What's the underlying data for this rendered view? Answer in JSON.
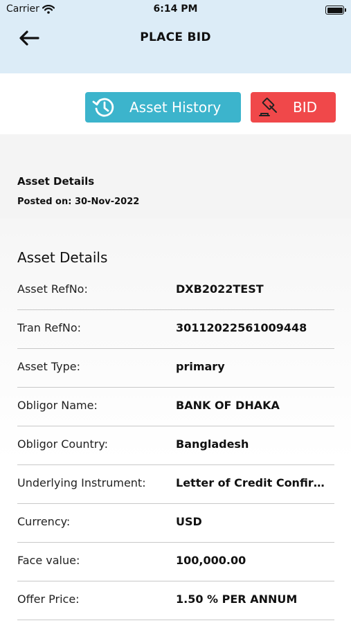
{
  "status_bar": {
    "carrier": "Carrier",
    "time": "6:14 PM"
  },
  "nav": {
    "title": "PLACE BID"
  },
  "actions": {
    "history_label": "Asset History",
    "bid_label": "BID"
  },
  "summary": {
    "title": "Asset Details",
    "posted": "Posted on: 30-Nov-2022"
  },
  "details": {
    "title": "Asset Details",
    "rows": [
      {
        "label": "Asset RefNo:",
        "value": "DXB2022TEST"
      },
      {
        "label": "Tran RefNo:",
        "value": "30112022561009448"
      },
      {
        "label": "Asset Type:",
        "value": "primary"
      },
      {
        "label": "Obligor Name:",
        "value": "BANK OF DHAKA"
      },
      {
        "label": "Obligor Country:",
        "value": "Bangladesh"
      },
      {
        "label": "Underlying Instrument:",
        "value": "Letter of Credit Confirm..."
      },
      {
        "label": "Currency:",
        "value": "USD"
      },
      {
        "label": "Face value:",
        "value": "100,000.00"
      },
      {
        "label": "Offer Price:",
        "value": "1.50 % PER ANNUM"
      }
    ]
  },
  "colors": {
    "header_bg": "#dcecf7",
    "history_button": "#3cb4cc",
    "bid_button": "#f0484a"
  },
  "icons": [
    "wifi-icon",
    "battery-icon",
    "back-arrow-icon",
    "history-icon",
    "gavel-icon"
  ]
}
